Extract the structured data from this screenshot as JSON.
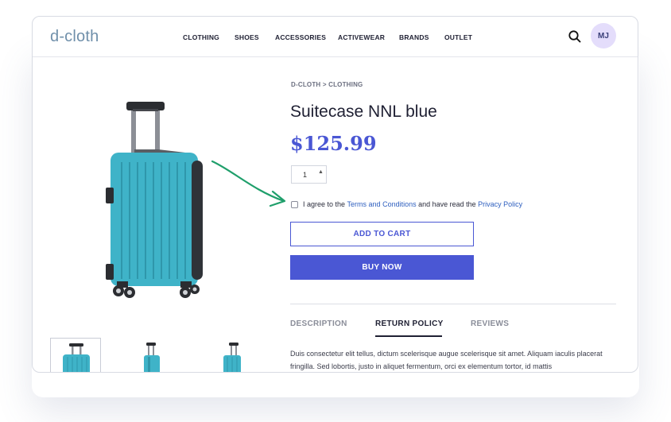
{
  "brand": {
    "logo": "d-cloth"
  },
  "nav": {
    "items": [
      {
        "label": "CLOTHING"
      },
      {
        "label": "SHOES"
      },
      {
        "label": "ACCESSORIES"
      },
      {
        "label": "ACTIVEWEAR"
      },
      {
        "label": "BRANDS"
      },
      {
        "label": "OUTLET"
      }
    ],
    "search_icon": "search-icon",
    "avatar_initials": "MJ"
  },
  "product": {
    "breadcrumb": "D-CLOTH > CLOTHING",
    "title": "Suitecase NNL blue",
    "price": "$125.99",
    "quantity": "1",
    "color": "#3fb3c8"
  },
  "agreement": {
    "prefix": "I agree to the ",
    "terms_link": "Terms and Conditions",
    "middle": " and have read the ",
    "privacy_link": "Privacy Policy",
    "checked": false
  },
  "buttons": {
    "add_to_cart": "ADD TO CART",
    "buy_now": "BUY NOW"
  },
  "tabs": {
    "items": [
      {
        "label": "DESCRIPTION"
      },
      {
        "label": "RETURN POLICY"
      },
      {
        "label": "REVIEWS"
      }
    ],
    "active": "RETURN POLICY",
    "content": "Duis consectetur elit tellus, dictum scelerisque augue scelerisque sit amet. Aliquam iaculis placerat fringilla. Sed lobortis, justo in aliquet fermentum, orci ex elementum tortor, id mattis"
  },
  "colors": {
    "accent": "#4a57d4",
    "link": "#2e5fbf",
    "arrow": "#1f9f6b",
    "avatar_bg": "#e4ddfb"
  }
}
